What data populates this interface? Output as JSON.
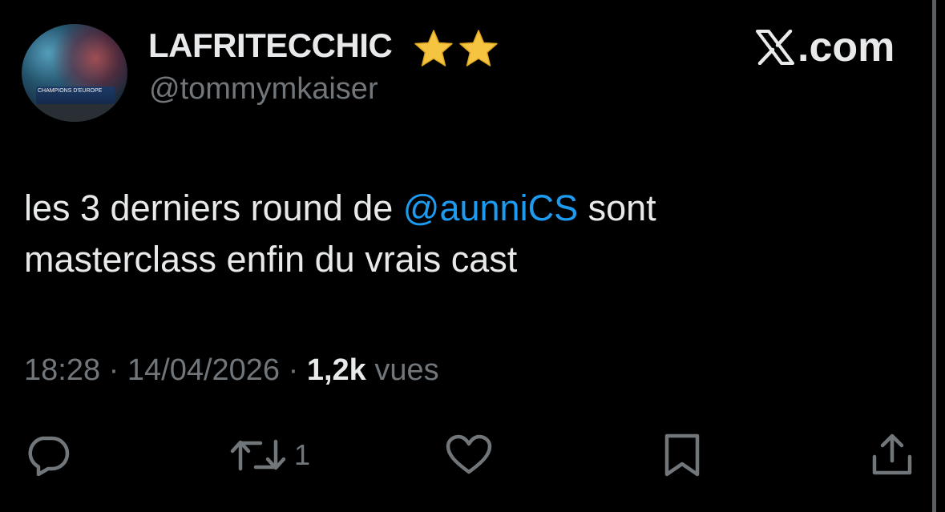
{
  "author": {
    "display_name": "LAFRITECCHIC",
    "badges": [
      "star-emoji",
      "star-emoji"
    ],
    "handle": "@tommymkaiser",
    "avatar_caption": "CHAMPIONS D'EUROPE"
  },
  "brand": {
    "label": ".com",
    "icon": "x-logo-icon"
  },
  "tweet": {
    "text_before_mention": "les 3 derniers round de ",
    "mention": "@aunniCS",
    "text_after_mention": " sont masterclass enfin du vrais cast",
    "time": "18:28",
    "separator": "·",
    "date": "14/04/2026",
    "views_count": "1,2k",
    "views_label": "vues"
  },
  "actions": {
    "reply": {
      "icon": "reply-icon"
    },
    "retweet": {
      "icon": "retweet-icon",
      "count": "1"
    },
    "like": {
      "icon": "heart-icon"
    },
    "bookmark": {
      "icon": "bookmark-icon"
    },
    "share": {
      "icon": "share-icon"
    }
  },
  "colors": {
    "background": "#000000",
    "text": "#e7e9ea",
    "secondary": "#71767b",
    "mention": "#1d9bf0",
    "star": "#f5c542"
  }
}
